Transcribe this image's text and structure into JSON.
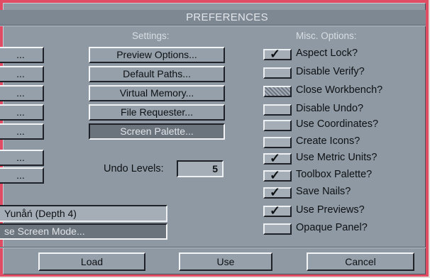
{
  "window": {
    "title": "PREFERENCES"
  },
  "sections": {
    "settings": "Settings:",
    "misc": "Misc. Options:"
  },
  "settings_buttons": [
    {
      "label": "Preview Options..."
    },
    {
      "label": "Default Paths..."
    },
    {
      "label": "Virtual Memory..."
    },
    {
      "label": "File Requester..."
    },
    {
      "label": "Screen Palette..."
    }
  ],
  "left_stubs": [
    {
      "label": "..."
    },
    {
      "label": "..."
    },
    {
      "label": "..."
    },
    {
      "label": "..."
    },
    {
      "label": "..."
    },
    {
      "label": "..."
    },
    {
      "label": "..."
    }
  ],
  "undo": {
    "label": "Undo Levels:",
    "value": "5"
  },
  "screen_mode": {
    "display": "Yunåń (Depth 4)",
    "button": "se Screen Mode..."
  },
  "misc_options": [
    {
      "label": "Aspect Lock?",
      "checked": true,
      "state": "checked"
    },
    {
      "label": "Disable Verify?",
      "checked": false,
      "state": "off"
    },
    {
      "label": "Close Workbench?",
      "checked": false,
      "state": "dithered"
    },
    {
      "label": "Disable Undo?",
      "checked": false,
      "state": "off"
    },
    {
      "label": "Use Coordinates?",
      "checked": false,
      "state": "off"
    },
    {
      "label": "Create Icons?",
      "checked": false,
      "state": "off"
    },
    {
      "label": "Use Metric Units?",
      "checked": true,
      "state": "checked"
    },
    {
      "label": "Toolbox Palette?",
      "checked": true,
      "state": "checked"
    },
    {
      "label": "Save Nails?",
      "checked": true,
      "state": "checked"
    },
    {
      "label": "Use Previews?",
      "checked": true,
      "state": "checked"
    },
    {
      "label": "Opaque Panel?",
      "checked": false,
      "state": "off"
    }
  ],
  "bottom_buttons": {
    "load": "Load",
    "use": "Use",
    "cancel": "Cancel"
  },
  "icons": {
    "check": "checkmark-icon"
  },
  "colors": {
    "frame": "#e04c64",
    "panel": "#8f99a3",
    "button": "#96a0aa"
  }
}
